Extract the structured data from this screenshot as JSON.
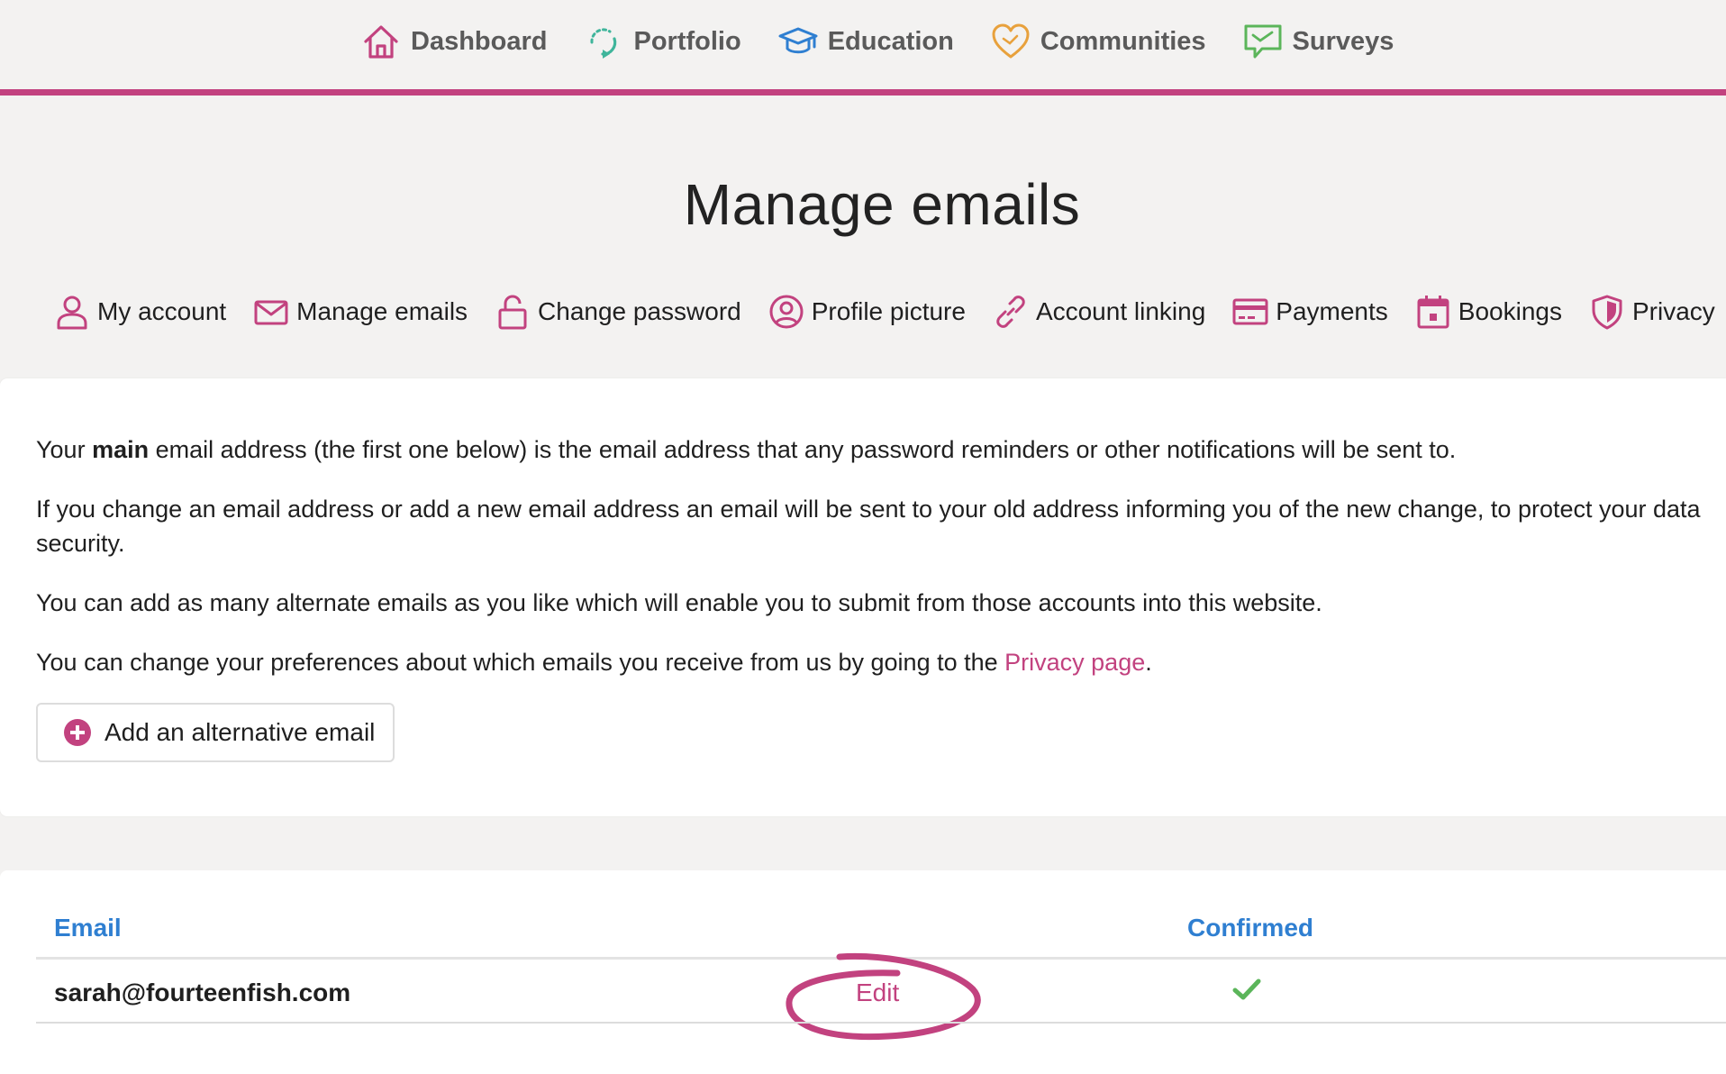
{
  "topnav": {
    "items": [
      {
        "label": "Dashboard",
        "icon": "home-icon",
        "color": "#c2427f"
      },
      {
        "label": "Portfolio",
        "icon": "refresh-icon",
        "color": "#3fb59b"
      },
      {
        "label": "Education",
        "icon": "graduation-cap-icon",
        "color": "#2f7fd1"
      },
      {
        "label": "Communities",
        "icon": "heart-icon",
        "color": "#e8a13c"
      },
      {
        "label": "Surveys",
        "icon": "chat-bubble-icon",
        "color": "#5bb55a"
      }
    ],
    "accent": "#c2427f"
  },
  "page": {
    "title": "Manage emails"
  },
  "subnav": {
    "items": [
      {
        "label": "My account",
        "icon": "user-icon"
      },
      {
        "label": "Manage emails",
        "icon": "envelope-icon"
      },
      {
        "label": "Change password",
        "icon": "lock-icon"
      },
      {
        "label": "Profile picture",
        "icon": "user-circle-icon"
      },
      {
        "label": "Account linking",
        "icon": "link-icon"
      },
      {
        "label": "Payments",
        "icon": "credit-card-icon"
      },
      {
        "label": "Bookings",
        "icon": "calendar-icon"
      },
      {
        "label": "Privacy",
        "icon": "shield-icon"
      }
    ],
    "icon_color": "#c2427f"
  },
  "info": {
    "p1_before": "Your ",
    "p1_bold": "main",
    "p1_after": " email address (the first one below) is the email address that any password reminders or other notifications will be sent to.",
    "p2": "If you change an email address or add a new email address an email will be sent to your old address informing you of the new change, to protect your data security.",
    "p3": "You can add as many alternate emails as you like which will enable you to submit from those accounts into this website.",
    "p4_before": "You can change your preferences about which emails you receive from us by going to the ",
    "p4_link": "Privacy page",
    "p4_after": ".",
    "add_button_label": "Add an alternative email"
  },
  "email_table": {
    "headers": {
      "email": "Email",
      "confirmed": "Confirmed"
    },
    "rows": [
      {
        "email": "sarah@fourteenfish.com",
        "action": "Edit",
        "confirmed": true
      }
    ],
    "header_color": "#2f7fd1",
    "check_color": "#5bb55a"
  }
}
